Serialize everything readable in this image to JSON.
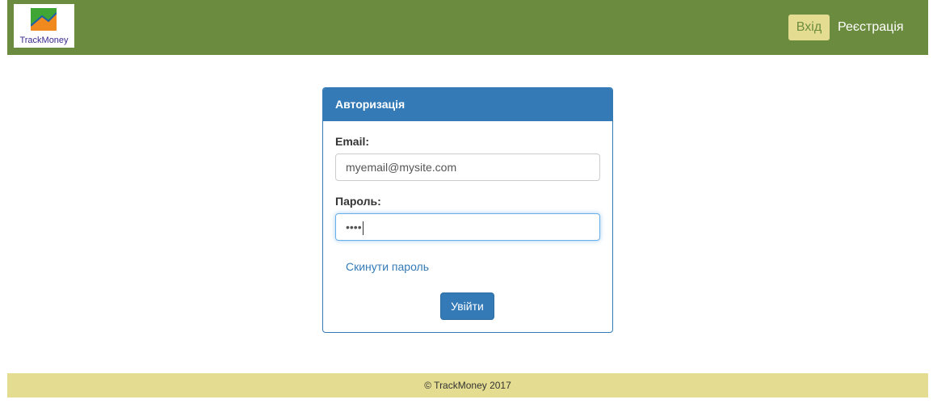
{
  "brand": {
    "logo_text": "TrackMoney",
    "colors": {
      "navbar": "#6b8c3e",
      "accent": "#e4dc90",
      "primary": "#337ab7"
    }
  },
  "nav": {
    "login_label": "Вхід",
    "register_label": "Реєстрація"
  },
  "login_panel": {
    "title": "Авторизація",
    "email_label": "Email:",
    "email_value": "myemail@mysite.com",
    "password_label": "Пароль:",
    "password_value": "••••",
    "reset_link": "Скинути пароль",
    "submit_label": "Увійти"
  },
  "footer": {
    "text": "© TrackMoney 2017"
  },
  "icons": {
    "logo": "trend-chart-icon"
  }
}
